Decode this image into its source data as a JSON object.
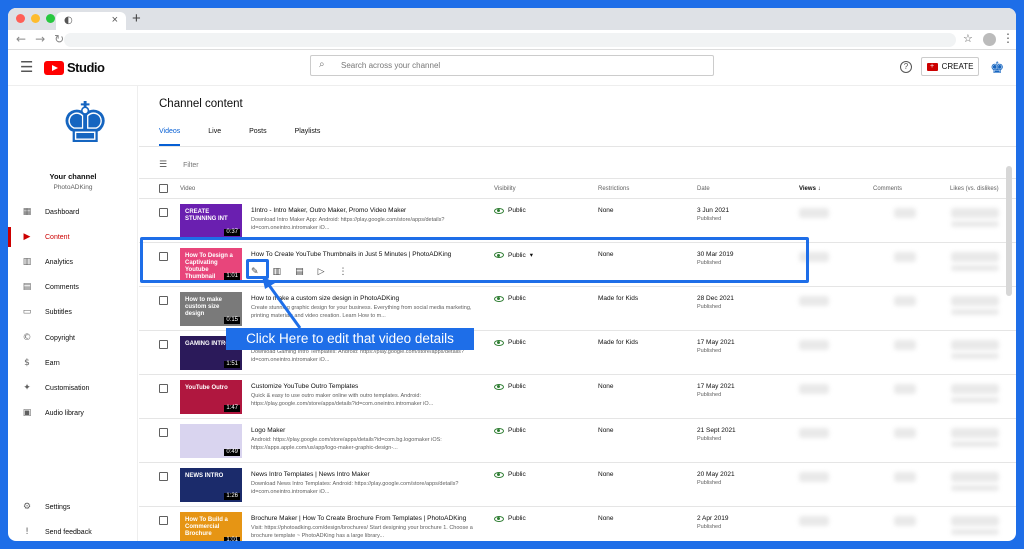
{
  "browser": {
    "tab_icon": "◐",
    "tab_close": "×",
    "new_tab": "+",
    "back": "←",
    "forward": "→",
    "reload": "↻",
    "star": "☆",
    "more": "⋮"
  },
  "header": {
    "menu_glyph": "☰",
    "brand": "Studio",
    "search_placeholder": "Search across your channel",
    "search_glyph": "⌕",
    "help_glyph": "?",
    "create_label": "CREATE",
    "create_glyph": "+",
    "avatar_glyph": "♚"
  },
  "sidebar": {
    "avatar_glyph": "♚",
    "channel_label": "Your channel",
    "channel_name": "PhotoADKing",
    "items": [
      {
        "label": "Dashboard",
        "icon": "▦"
      },
      {
        "label": "Content",
        "icon": "▶"
      },
      {
        "label": "Analytics",
        "icon": "▥"
      },
      {
        "label": "Comments",
        "icon": "▤"
      },
      {
        "label": "Subtitles",
        "icon": "▭"
      },
      {
        "label": "Copyright",
        "icon": "©"
      },
      {
        "label": "Earn",
        "icon": "$"
      },
      {
        "label": "Customisation",
        "icon": "✦"
      },
      {
        "label": "Audio library",
        "icon": "▣"
      }
    ],
    "bottom_items": [
      {
        "label": "Settings",
        "icon": "⚙"
      },
      {
        "label": "Send feedback",
        "icon": "!"
      }
    ]
  },
  "main": {
    "title": "Channel content",
    "tabs": [
      "Videos",
      "Live",
      "Posts",
      "Playlists"
    ],
    "filter_label": "Filter",
    "filter_glyph": "☰",
    "columns": {
      "video": "Video",
      "visibility": "Visibility",
      "restrictions": "Restrictions",
      "date": "Date",
      "views": "Views ↓",
      "comments": "Comments",
      "likes": "Likes (vs. dislikes)"
    },
    "row_icons": {
      "edit": "✎",
      "analytics": "▥",
      "comments": "▤",
      "youtube": "▷",
      "more": "⋮"
    },
    "videos": [
      {
        "thumb_text": "CREATE STUNNING INT",
        "duration": "0:37",
        "title": "1Intro - Intro Maker, Outro Maker, Promo Video Maker",
        "desc": "Download Intro Maker App: Android: https://play.google.com/store/apps/details?id=com.oneintro.intromaker iO...",
        "visibility": "Public",
        "restrictions": "None",
        "date": "3 Jun 2021",
        "date_status": "Published",
        "thumb_color": "#6a1fb0"
      },
      {
        "thumb_text": "How To Design a Captivating Youtube Thumbnail",
        "duration": "1:01",
        "title": "How To Create YouTube Thumbnails in Just 5 Minutes | PhotoADKing",
        "desc": "",
        "visibility": "Public",
        "visibility_menu": "▾",
        "restrictions": "None",
        "date": "30 Mar 2019",
        "date_status": "Published",
        "thumb_color": "#e8457b"
      },
      {
        "thumb_text": "How to make custom size design",
        "duration": "0:15",
        "title": "How to make a custom size design in PhotoADKing",
        "desc": "Create stunning graphic design for your business. Everything from social media marketing, printing materials and video creation. Learn How to m...",
        "visibility": "Public",
        "restrictions": "Made for Kids",
        "date": "28 Dec 2021",
        "date_status": "Published",
        "thumb_color": "#7a7a7a"
      },
      {
        "thumb_text": "GAMING INTRO",
        "duration": "1:51",
        "title": "Gaming Intro Templates",
        "desc": "Download Gaming Intro Templates: Android: https://play.google.com/store/apps/details?id=com.oneintro.intromaker iO...",
        "visibility": "Public",
        "restrictions": "Made for Kids",
        "date": "17 May 2021",
        "date_status": "Published",
        "thumb_color": "#2b1a5a"
      },
      {
        "thumb_text": "YouTube Outro",
        "duration": "1:47",
        "title": "Customize YouTube Outro Templates",
        "desc": "Quick & easy to use outro maker online with outro templates. Android: https://play.google.com/store/apps/details?id=com.oneintro.intromaker iO...",
        "visibility": "Public",
        "restrictions": "None",
        "date": "17 May 2021",
        "date_status": "Published",
        "thumb_color": "#b0173f"
      },
      {
        "thumb_text": "",
        "duration": "0:49",
        "title": "Logo Maker",
        "desc": "Android: https://play.google.com/store/apps/details?id=com.bg.logomaker iOS: https://apps.apple.com/us/app/logo-maker-graphic-design-...",
        "visibility": "Public",
        "restrictions": "None",
        "date": "21 Sept 2021",
        "date_status": "Published",
        "thumb_color": "#d9d4ef"
      },
      {
        "thumb_text": "NEWS INTRO",
        "duration": "1:26",
        "title": "News Intro Templates | News Intro Maker",
        "desc": "Download News Intro Templates: Android: https://play.google.com/store/apps/details?id=com.oneintro.intromaker iO...",
        "visibility": "Public",
        "restrictions": "None",
        "date": "20 May 2021",
        "date_status": "Published",
        "thumb_color": "#1b2b6b"
      },
      {
        "thumb_text": "How To Build a Commercial Brochure",
        "duration": "1:01",
        "title": "Brochure Maker | How To Create Brochure From Templates | PhotoADKing",
        "desc": "Visit: https://photoadking.com/design/brochures/ Start designing your brochure 1. Choose a brochure template ~ PhotoADKing has a large library...",
        "visibility": "Public",
        "restrictions": "None",
        "date": "2 Apr 2019",
        "date_status": "Published",
        "thumb_color": "#e69514"
      }
    ]
  },
  "annotation": {
    "callout": "Click Here to edit that video details"
  }
}
